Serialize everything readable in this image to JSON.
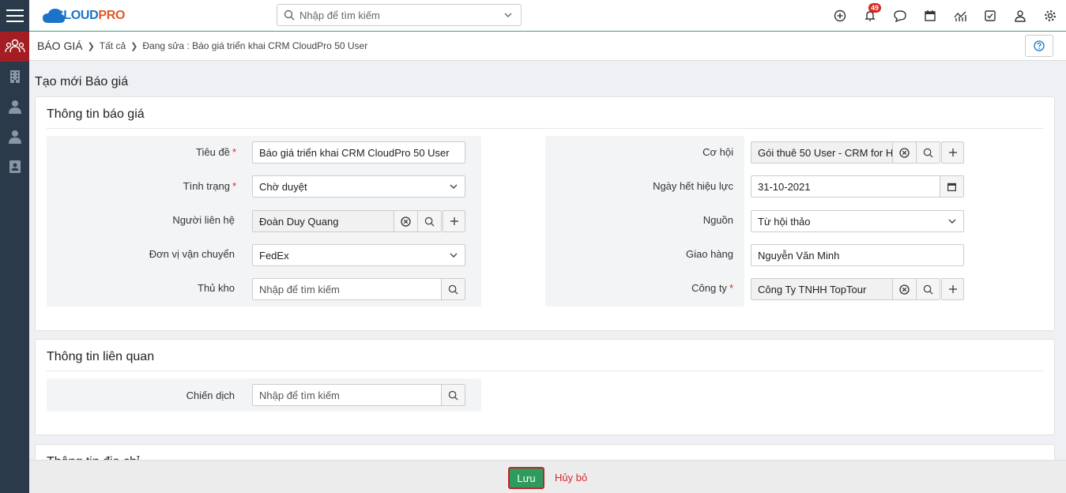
{
  "app": {
    "logo_text_a": "CLOUD",
    "logo_text_b": "PRO",
    "search_placeholder": "Nhập để tìm kiếm",
    "notification_count": "49"
  },
  "breadcrumb": {
    "module": "BÁO GIÁ",
    "all": "Tất cả",
    "editing": "Đang sửa : Báo giá triển khai CRM CloudPro 50 User"
  },
  "page_title": "Tạo mới Báo giá",
  "section_quote": {
    "title": "Thông tin báo giá",
    "left": {
      "title_label": "Tiêu đề",
      "title_value": "Báo giá triển khai CRM CloudPro 50 User",
      "status_label": "Tình trạng",
      "status_value": "Chờ duyệt",
      "contact_label": "Người liên hệ",
      "contact_value": "Đoàn Duy Quang",
      "carrier_label": "Đơn vị vận chuyển",
      "carrier_value": "FedEx",
      "warehouse_label": "Thủ kho",
      "warehouse_placeholder": "Nhập để tìm kiếm"
    },
    "right": {
      "opportunity_label": "Cơ hội",
      "opportunity_value": "Gói thuê 50 User - CRM for H",
      "expiry_label": "Ngày hết hiệu lực",
      "expiry_value": "31-10-2021",
      "source_label": "Nguồn",
      "source_value": "Từ hội thảo",
      "delivery_label": "Giao hàng",
      "delivery_value": "Nguyễn Văn Minh",
      "company_label": "Công ty",
      "company_value": "Công Ty TNHH TopTour"
    }
  },
  "section_related": {
    "title": "Thông tin liên quan",
    "campaign_label": "Chiến dịch",
    "campaign_placeholder": "Nhập để tìm kiếm"
  },
  "section_address": {
    "title": "Thông tin địa chỉ"
  },
  "footer": {
    "save_label": "Lưu",
    "cancel_label": "Hủy bỏ"
  },
  "colors": {
    "accent_green": "#2e9b5e",
    "sidebar_dark": "#2b3a4a",
    "active_red": "#a31d23",
    "required_red": "#d9261c"
  }
}
